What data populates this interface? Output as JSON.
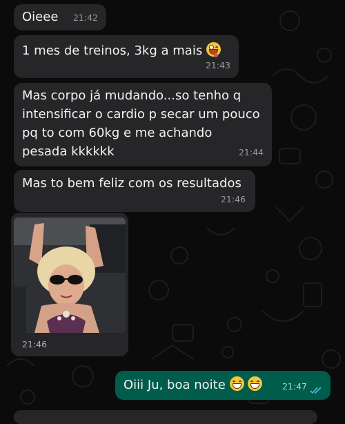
{
  "messages": [
    {
      "id": "m1",
      "text": "Oieee",
      "time": "21:42",
      "emoji": ""
    },
    {
      "id": "m2",
      "text": "1 mes de treinos, 3kg a mais",
      "time": "21:43",
      "emoji": "zany-face"
    },
    {
      "id": "m3",
      "text": "Mas corpo já mudando...so tenho q\nintensificar o cardio p secar um pouco\npq to com 60kg e me achando\npesada kkkkkk",
      "time": "21:44",
      "emoji": ""
    },
    {
      "id": "m4",
      "text": "Mas to bem feliz com os resultados",
      "time": "21:46",
      "emoji": ""
    },
    {
      "id": "m5",
      "type": "gif",
      "time": "21:46"
    },
    {
      "id": "m6",
      "text": "Oiii Ju, boa noite",
      "time": "21:47",
      "emoji": "grinning-face",
      "direction": "out",
      "status": "read"
    }
  ],
  "colors": {
    "incoming_bubble": "#262628",
    "outgoing_bubble": "#005c4b",
    "read_ticks": "#53bdeb",
    "background": "#0b0b0b"
  },
  "icons": [
    "zany-face-emoji",
    "grinning-face-emoji",
    "double-check-read-icon"
  ]
}
